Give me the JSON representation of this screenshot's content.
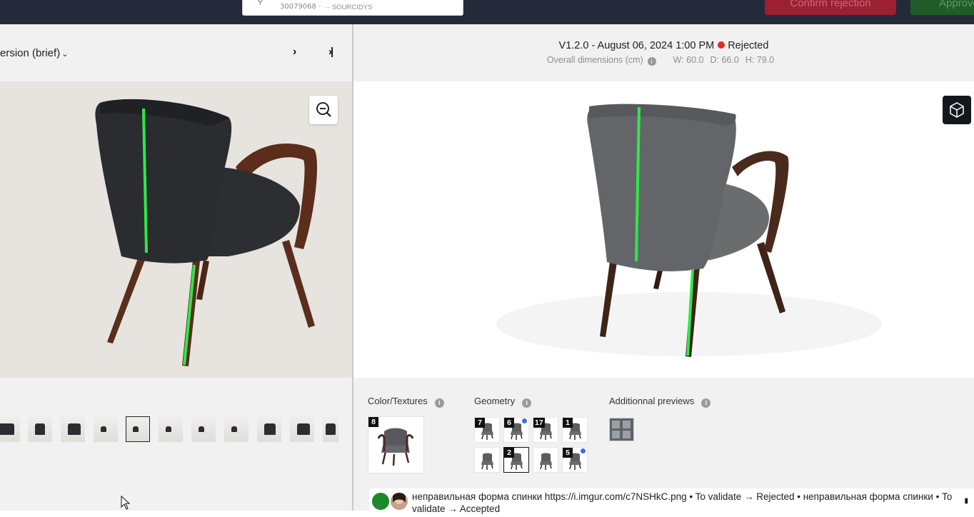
{
  "topbar": {
    "search": {
      "sku": "30079068 ·",
      "vendor": "·· SOURCIDYS"
    },
    "confirm_rejection_label": "Confirm rejection",
    "approve_label": "Approve"
  },
  "left": {
    "version_select": "ersion (brief)",
    "nav_next": "›",
    "nav_last": "›|",
    "thumbnail_count": 11,
    "selected_thumbnail_index": 4
  },
  "right": {
    "version_label": "V1.2.0 - August 06, 2024 1:00 PM",
    "status_label": "Rejected",
    "status_color": "#e02b2b",
    "dims_label": "Overall dimensions (cm)",
    "dims": {
      "w": "W: 60.0",
      "d": "D: 66.0",
      "h": "H: 79.0"
    },
    "sections": {
      "color_textures": "Color/Textures",
      "geometry": "Geometry",
      "additional_previews": "Additionnal previews"
    },
    "texture_badge": "8",
    "geometry_thumbs": [
      {
        "badge": "7",
        "dot": false,
        "selected": false
      },
      {
        "badge": "6",
        "dot": true,
        "selected": false
      },
      {
        "badge": "17",
        "dot": false,
        "selected": false
      },
      {
        "badge": "1",
        "dot": false,
        "selected": false
      },
      {
        "badge": "",
        "dot": false,
        "selected": false
      },
      {
        "badge": "2",
        "dot": false,
        "selected": true
      },
      {
        "badge": "",
        "dot": false,
        "selected": false
      },
      {
        "badge": "5",
        "dot": true,
        "selected": false
      }
    ]
  },
  "comment": {
    "text": "неправильная форма спинки https://i.imgur.com/c7NSHkC.png • To validate → Rejected • неправильная форма спинки • To validate → Accepted"
  },
  "icons": {
    "zoom": "zoom-out-icon",
    "cube": "3d-cube-icon",
    "info": "info-icon"
  },
  "colors": {
    "topbar": "#252a3b",
    "reject_button": "#9c1f32",
    "approve_button": "#1f5c27",
    "annotation_line": "#2ee84a"
  }
}
